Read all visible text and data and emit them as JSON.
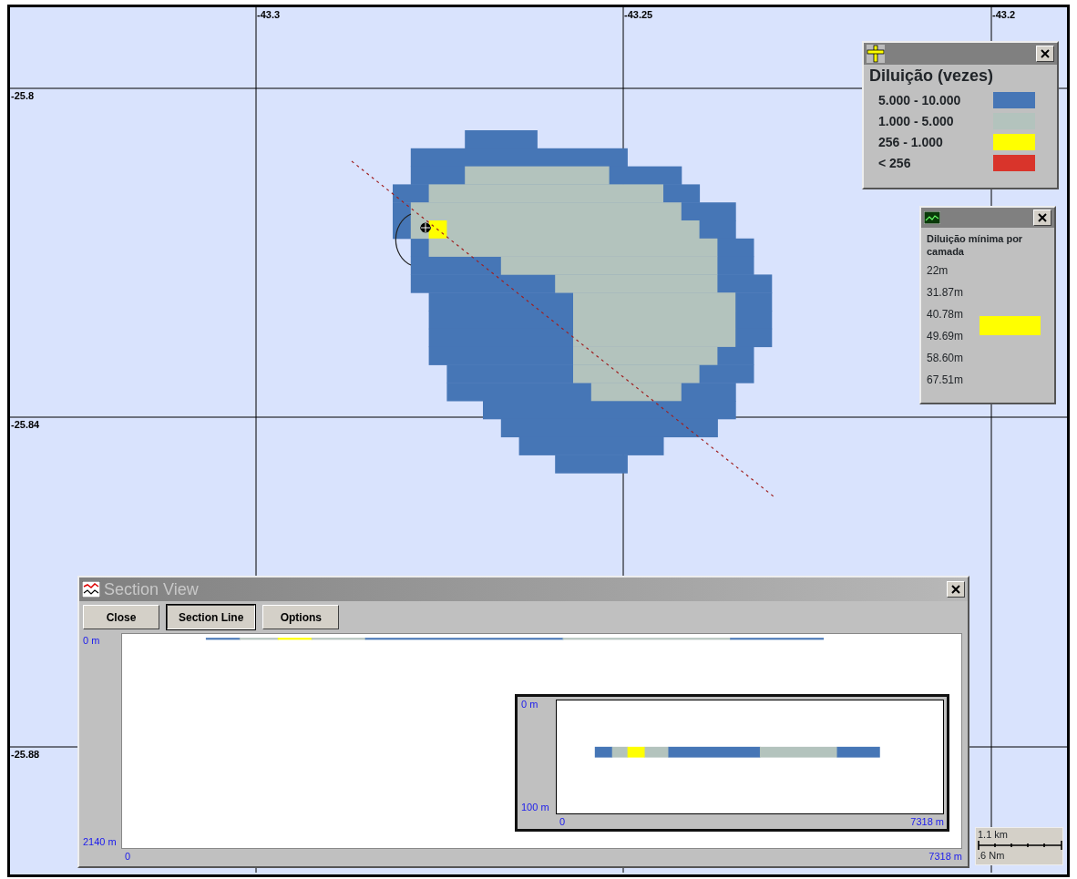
{
  "map": {
    "longitude_labels": [
      "-43.3",
      "-43.25",
      "-43.2"
    ],
    "latitude_labels": [
      "-25.8",
      "-25.84",
      "-25.88"
    ]
  },
  "legend": {
    "title": "Diluição (vezes)",
    "items": [
      {
        "label": "5.000 - 10.000",
        "color": "#4676b6"
      },
      {
        "label": "1.000 - 5.000",
        "color": "#b3c3bd"
      },
      {
        "label": "256 - 1.000",
        "color": "#ffff00"
      },
      {
        "label": "< 256",
        "color": "#d9342b"
      }
    ]
  },
  "layer_panel": {
    "title": "Diluição mínima por camada",
    "layers": [
      "22m",
      "31.87m",
      "40.78m",
      "49.69m",
      "58.60m",
      "67.51m"
    ],
    "bar": {
      "color": "#ffff00"
    }
  },
  "section_view": {
    "title": "Section View",
    "buttons": [
      {
        "label": "Close",
        "selected": false
      },
      {
        "label": "Section Line",
        "selected": true
      },
      {
        "label": "Options",
        "selected": false
      }
    ],
    "plot": {
      "y_top": "0 m",
      "y_bottom": "2140 m",
      "x_start": "0",
      "x_end": "7318 m",
      "segments": [
        {
          "color": "#4676b6"
        },
        {
          "color": "#b3c3bd"
        },
        {
          "color": "#ffff00"
        },
        {
          "color": "#b3c3bd"
        },
        {
          "color": "#4676b6"
        },
        {
          "color": "#b3c3bd"
        },
        {
          "color": "#4676b6"
        }
      ]
    },
    "inset": {
      "y_top": "0 m",
      "y_bottom": "100 m",
      "x_start": "0",
      "x_end": "7318 m",
      "segments": [
        {
          "color": "#4676b6"
        },
        {
          "color": "#b3c3bd"
        },
        {
          "color": "#ffff00"
        },
        {
          "color": "#b3c3bd"
        },
        {
          "color": "#4676b6"
        },
        {
          "color": "#b3c3bd"
        },
        {
          "color": "#4676b6"
        }
      ]
    }
  },
  "scale_bar": {
    "top": "1.1 km",
    "bottom": ".6 Nm"
  }
}
